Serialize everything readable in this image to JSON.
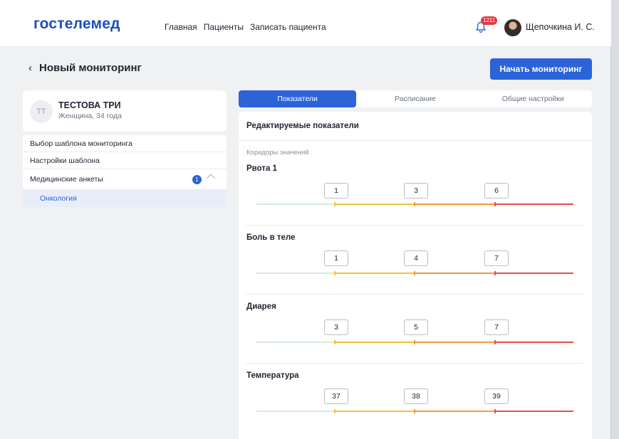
{
  "header": {
    "logo": "гостелемед",
    "nav": [
      "Главная",
      "Пациенты",
      "Записать пациента"
    ],
    "notifications_count": "1211",
    "user_name": "Щепочкина И. С."
  },
  "page": {
    "title": "Новый мониторинг",
    "start_button": "Начать мониторинг"
  },
  "patient": {
    "initials": "ТТ",
    "name": "ТЕСТОВА ТРИ",
    "info": "Женщина, 34 года"
  },
  "menu": {
    "items": [
      "Выбор шаблона мониторинга",
      "Настройки шаблона"
    ],
    "group_label": "Медицинские анкеты",
    "group_count": "1",
    "sub_item": "Онкология"
  },
  "tabs": [
    "Показатели",
    "Расписание",
    "Общие настройки"
  ],
  "panel": {
    "title": "Редактируемые показатели",
    "section_label": "Коридоры значений",
    "metrics": [
      {
        "name": "Рвота 1",
        "values": [
          "1",
          "3",
          "6"
        ]
      },
      {
        "name": "Боль в теле",
        "values": [
          "1",
          "4",
          "7"
        ]
      },
      {
        "name": "Диарея",
        "values": [
          "3",
          "5",
          "7"
        ]
      },
      {
        "name": "Температура",
        "values": [
          "37",
          "38",
          "39"
        ]
      }
    ]
  },
  "colors": {
    "brand": "#1e4fb8",
    "accent": "#2c63d9",
    "zone_normal": "#d8ead8",
    "zone_low": "#f0c43a",
    "zone_mid": "#f09a3c",
    "zone_high": "#ec4a48"
  }
}
